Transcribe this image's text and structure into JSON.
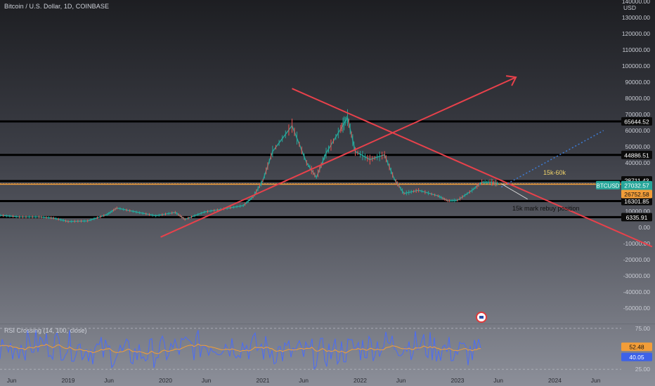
{
  "chart_header": {
    "title": "Bitcoin / U.S. Dollar, 1D, COINBASE",
    "currency": "USD"
  },
  "rsi_header": {
    "title": "RSI Crossing (14, 100, close)"
  },
  "annotations": {
    "range_note": "15k-60k",
    "rebuy_note": "15k mark rebuy position"
  },
  "colors": {
    "horizontal_line": "#000000",
    "trend_line": "#e8414b",
    "price": "#26a69a",
    "price_down": "#ef5350",
    "orange_line": "#f29d38",
    "rsi_fast": "#4a6cf7",
    "rsi_slow": "#f29d38",
    "dotted_projection": "#3d7dd8",
    "label_black": "#0b0b0b",
    "label_green": "#26a69a",
    "label_orange": "#f29d38",
    "label_blue": "#3d62e8",
    "axis_text": "#c9ccd4"
  },
  "chart_data": [
    {
      "type": "line",
      "title": "Bitcoin / U.S. Dollar, 1D, COINBASE",
      "ylabel": "USD",
      "ylim": [
        -50000,
        140000
      ],
      "x_ticks": [
        "Jun",
        "2019",
        "Jun",
        "2020",
        "Jun",
        "2021",
        "Jun",
        "2022",
        "Jun",
        "2023",
        "Jun",
        "2024",
        "Jun"
      ],
      "y_ticks": [
        140000,
        130000,
        120000,
        110000,
        100000,
        90000,
        80000,
        70000,
        60000,
        50000,
        40000,
        30000,
        20000,
        10000,
        0,
        -10000,
        -20000,
        -30000,
        -40000,
        -50000
      ],
      "y_tick_labels": [
        "140000.00",
        "130000.00",
        "120000.00",
        "110000.00",
        "100000.00",
        "90000.00",
        "80000.00",
        "70000.00",
        "60000.00",
        "50000.00",
        "40000.00",
        "30000.00",
        "20000.00",
        "10000.00",
        "0.00",
        "-10000.00",
        "-20000.00",
        "-30000.00",
        "-40000.00",
        "-50000.00"
      ],
      "horizontal_levels": [
        65644.52,
        44886.51,
        28711.43,
        16301.85,
        6335.91
      ],
      "horizontal_labels": [
        "65644.52",
        "44886.51",
        "28711.43",
        "16301.85",
        "6335.91"
      ],
      "orange_level": 26752.58,
      "orange_label": "26752.58",
      "symbol": "BTCUSD",
      "last_price": 27032.57,
      "last_price_label": "27032.57",
      "countdown": "07:23:27",
      "series": [
        {
          "name": "BTCUSD",
          "points": [
            [
              2018.3,
              7500
            ],
            [
              2018.5,
              6500
            ],
            [
              2018.7,
              6500
            ],
            [
              2018.85,
              5800
            ],
            [
              2019.0,
              3600
            ],
            [
              2019.2,
              4000
            ],
            [
              2019.4,
              8000
            ],
            [
              2019.5,
              12000
            ],
            [
              2019.7,
              9500
            ],
            [
              2019.9,
              7200
            ],
            [
              2020.1,
              9300
            ],
            [
              2020.2,
              5000
            ],
            [
              2020.4,
              9500
            ],
            [
              2020.6,
              11500
            ],
            [
              2020.8,
              13500
            ],
            [
              2020.9,
              19000
            ],
            [
              2021.0,
              29000
            ],
            [
              2021.1,
              47000
            ],
            [
              2021.3,
              63000
            ],
            [
              2021.45,
              40000
            ],
            [
              2021.55,
              31000
            ],
            [
              2021.65,
              46000
            ],
            [
              2021.8,
              61000
            ],
            [
              2021.87,
              68000
            ],
            [
              2021.95,
              47000
            ],
            [
              2022.1,
              42000
            ],
            [
              2022.25,
              45000
            ],
            [
              2022.35,
              30000
            ],
            [
              2022.45,
              21000
            ],
            [
              2022.6,
              23000
            ],
            [
              2022.8,
              19500
            ],
            [
              2022.9,
              16500
            ],
            [
              2023.0,
              16800
            ],
            [
              2023.15,
              23000
            ],
            [
              2023.25,
              28000
            ],
            [
              2023.35,
              28000
            ],
            [
              2023.42,
              27032.57
            ]
          ]
        }
      ],
      "trend_lines": [
        {
          "from": [
            2021.3,
            86000
          ],
          "to": [
            2025.0,
            -12000
          ]
        },
        {
          "from": [
            2019.95,
            -6000
          ],
          "to": [
            2023.6,
            93000
          ]
        }
      ]
    },
    {
      "type": "line",
      "title": "RSI Crossing (14, 100, close)",
      "ylim": [
        20,
        80
      ],
      "y_ticks": [
        75,
        50,
        25
      ],
      "y_tick_labels": [
        "75.00",
        "50.00",
        "25.00"
      ],
      "series": [
        {
          "name": "RSI fast",
          "last_value": 40.05,
          "last_label": "40.05"
        },
        {
          "name": "RSI slow",
          "last_value": 52.48,
          "last_label": "52.48"
        }
      ]
    }
  ]
}
